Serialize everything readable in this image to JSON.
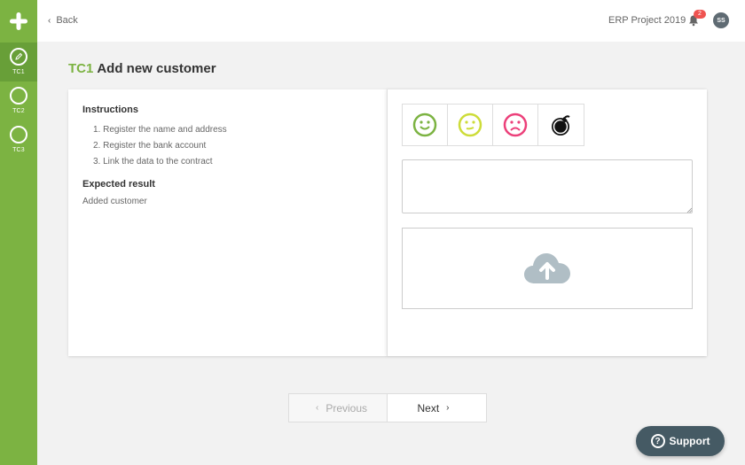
{
  "sidebar": {
    "logo_icon": "plus-logo-icon",
    "items": [
      {
        "label": "TC1",
        "icon": "pencil-icon",
        "active": true
      },
      {
        "label": "TC2",
        "icon": "circle-icon",
        "active": false
      },
      {
        "label": "TC3",
        "icon": "circle-icon",
        "active": false
      }
    ]
  },
  "header": {
    "back_label": "Back",
    "project": "ERP Project 2019",
    "notifications": "2",
    "avatar": "SS"
  },
  "page": {
    "tc": "TC1",
    "title": "Add new customer"
  },
  "instructions": {
    "heading": "Instructions",
    "steps": [
      "1. Register the name and address",
      "2. Register the bank account",
      "3. Link the data to the contract"
    ],
    "expected_heading": "Expected result",
    "expected": "Added customer"
  },
  "feedback": {
    "moods": [
      "happy-face-icon",
      "neutral-face-icon",
      "sad-face-icon",
      "bomb-icon"
    ],
    "comment_value": "",
    "upload_icon": "cloud-upload-icon"
  },
  "pager": {
    "previous": "Previous",
    "next": "Next"
  },
  "support": {
    "label": "Support"
  },
  "colors": {
    "accent": "#7cb342",
    "happy": "#7cb342",
    "neutral": "#cddc39",
    "sad": "#ec407a",
    "support_bg": "#455a64"
  }
}
